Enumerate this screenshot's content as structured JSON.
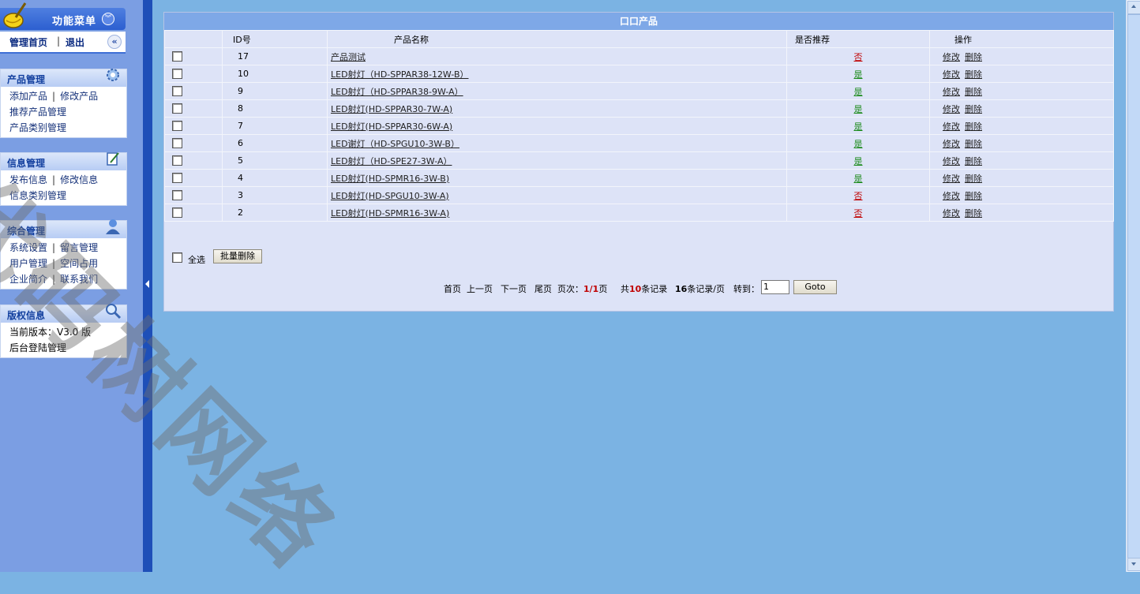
{
  "sidebar": {
    "menu_title": "功能菜单",
    "home_link": "管理首页",
    "logout_link": "退出",
    "panels": [
      {
        "title": "产品管理",
        "icon": "gear-icon",
        "rows": [
          [
            "添加产品",
            "修改产品"
          ],
          [
            "推荐产品管理"
          ],
          [
            "产品类别管理"
          ]
        ]
      },
      {
        "title": "信息管理",
        "icon": "edit-document-icon",
        "rows": [
          [
            "发布信息",
            "修改信息"
          ],
          [
            "信息类别管理"
          ]
        ]
      },
      {
        "title": "综合管理",
        "icon": "user-icon",
        "rows": [
          [
            "系统设置",
            "留言管理"
          ],
          [
            "用户管理",
            "空间占用"
          ],
          [
            "企业简介",
            "联系我们"
          ]
        ]
      },
      {
        "title": "版权信息",
        "icon": "magnifier-icon",
        "rows": [
          [
            "当前版本：V3.0 版"
          ],
          [
            "后台登陆管理"
          ]
        ]
      }
    ]
  },
  "main": {
    "title": "口口产品",
    "headers": {
      "id": "ID号",
      "name": "产品名称",
      "recommended": "是否推荐",
      "ops": "操作"
    },
    "rows": [
      {
        "id": "17",
        "name": "产品测试",
        "recommended": "否"
      },
      {
        "id": "10",
        "name": "LED射灯（HD-SPPAR38-12W-B）",
        "recommended": "是"
      },
      {
        "id": "9",
        "name": "LED射灯（HD-SPPAR38-9W-A）",
        "recommended": "是"
      },
      {
        "id": "8",
        "name": "LED射灯(HD-SPPAR30-7W-A)",
        "recommended": "是"
      },
      {
        "id": "7",
        "name": "LED射灯(HD-SPPAR30-6W-A)",
        "recommended": "是"
      },
      {
        "id": "6",
        "name": "LED谢灯（HD-SPGU10-3W-B）",
        "recommended": "是"
      },
      {
        "id": "5",
        "name": "LED射灯（HD-SPE27-3W-A）",
        "recommended": "是"
      },
      {
        "id": "4",
        "name": "LED射灯(HD-SPMR16-3W-B)",
        "recommended": "是"
      },
      {
        "id": "3",
        "name": "LED射灯(HD-SPGU10-3W-A)",
        "recommended": "否"
      },
      {
        "id": "2",
        "name": "LED射灯(HD-SPMR16-3W-A)",
        "recommended": "否"
      }
    ],
    "edit_label": "修改",
    "delete_label": "删除",
    "select_all": "全选",
    "batch_delete": "批量删除",
    "pager": {
      "first": "首页",
      "prev": "上一页",
      "next": "下一页",
      "last": "尾页",
      "page_prefix": "页次：",
      "page_current": "1/1",
      "page_suffix": "页",
      "total_prefix": "共",
      "total": "10",
      "total_suffix": "条记录",
      "per_page": "16",
      "per_page_suffix": "条记录/页",
      "goto_label": "转到：",
      "goto_value": "1",
      "goto_button": "Goto"
    }
  },
  "watermark": "代码树网络",
  "colors": {
    "yes": "#1a8a1a",
    "no": "#c00000",
    "background": "#7bb3e3",
    "sidebar": "#7b9ee3"
  }
}
